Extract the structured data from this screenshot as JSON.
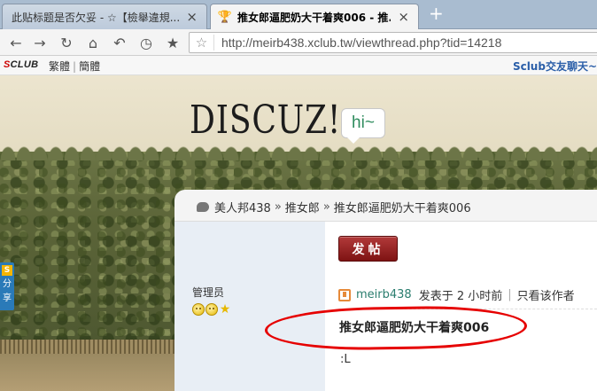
{
  "browser": {
    "tabs": [
      {
        "title": "此贴标题是否欠妥 - ☆【檢舉違規...",
        "active": false
      },
      {
        "title": "推女郎逼肥奶大干着爽006 - 推...",
        "active": true
      }
    ],
    "new_tab_symbol": "+",
    "address": "http://meirb438.xclub.tw/viewthread.php?tid=14218",
    "icons": [
      "back-icon",
      "forward-icon",
      "reload-icon",
      "home-icon",
      "undo-icon",
      "history-icon",
      "bookmark-star-icon"
    ]
  },
  "sitebar": {
    "logo_s": "S",
    "logo_rest": "CLUB",
    "lang_trad": "繁體",
    "lang_simp": "簡體",
    "chat_link": "Sclub交友聊天~"
  },
  "header": {
    "logo_text": "DISCUZ!",
    "bubble_text": "hi~"
  },
  "breadcrumb": {
    "items": [
      "美人邦438",
      "推女郎",
      "推女郎逼肥奶大干着爽006"
    ],
    "separator": "»"
  },
  "actions": {
    "post_button": "发帖"
  },
  "share": {
    "badge": "S",
    "label1": "分",
    "label2": "享"
  },
  "post": {
    "author_role": "管理员",
    "author": "meirb438",
    "posted_at": "发表于 2 小时前",
    "only_author": "只看该作者",
    "meta_sep": "|",
    "title": "推女郎逼肥奶大干着爽006",
    "body": ":L"
  },
  "colors": {
    "accent_red": "#e60000",
    "author_link": "#2a7d6e",
    "post_button": "#8b1a1a",
    "chat_link": "#2a5ea8"
  }
}
